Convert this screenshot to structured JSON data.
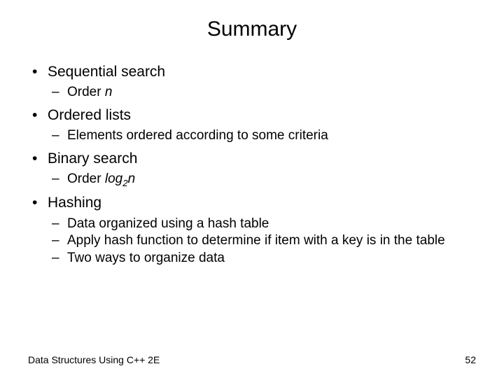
{
  "title": "Summary",
  "b1": "Sequential search",
  "b1s1a": "Order ",
  "b1s1b": "n",
  "b2": "Ordered lists",
  "b2s1": "Elements ordered according to some criteria",
  "b3": "Binary search",
  "b3s1a": "Order ",
  "b3s1b": "log",
  "b3s1c": "2",
  "b3s1d": "n",
  "b4": "Hashing",
  "b4s1": "Data organized using a hash table",
  "b4s2": "Apply hash function to determine if item with a key is in the table",
  "b4s3": "Two ways to organize data",
  "footer_left": "Data Structures Using C++ 2E",
  "footer_right": "52"
}
